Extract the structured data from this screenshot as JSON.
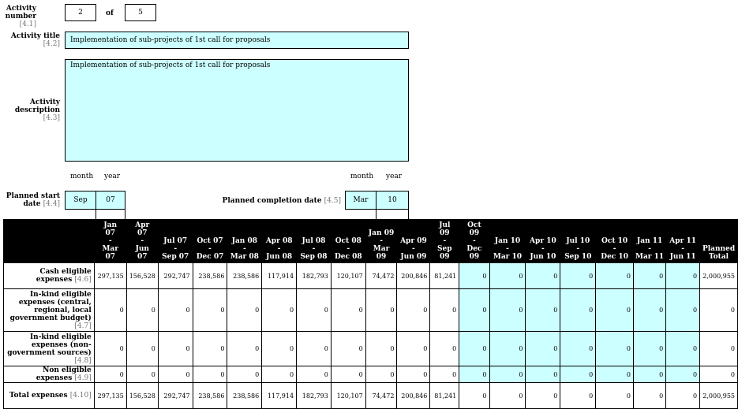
{
  "activity": {
    "number_label": "Activity number",
    "number_ref": "[4.1]",
    "number_value": "2",
    "of_label": "of",
    "total_value": "5",
    "title_label": "Activity title",
    "title_ref": "[4.2]",
    "title_value": "Implementation of sub-projects of 1st call for proposals",
    "desc_label": "Activity description",
    "desc_ref": "[4.3]",
    "desc_value": "Implementation of sub-projects of 1st call for proposals"
  },
  "dates": {
    "month_label": "month",
    "year_label": "year",
    "start_label": "Planned start date",
    "start_ref": "[4.4]",
    "start_month": "Sep",
    "start_year": "07",
    "completion_label": "Planned completion date",
    "completion_ref": "[4.5]",
    "completion_month": "Mar",
    "completion_year": "10"
  },
  "table": {
    "columns": [
      [
        "Jan",
        "07",
        "-",
        "Mar",
        "07"
      ],
      [
        "Apr",
        "07",
        "-",
        "Jun",
        "07"
      ],
      [
        "Jul 07",
        "-",
        "Sep 07"
      ],
      [
        "Oct 07",
        "-",
        "Dec 07"
      ],
      [
        "Jan 08",
        "-",
        "Mar 08"
      ],
      [
        "Apr 08",
        "-",
        "Jun 08"
      ],
      [
        "Jul 08",
        "-",
        "Sep 08"
      ],
      [
        "Oct 08",
        "-",
        "Dec 08"
      ],
      [
        "Jan 09",
        "-",
        "Mar",
        "09"
      ],
      [
        "Apr 09",
        "-",
        "Jun 09"
      ],
      [
        "Jul",
        "09",
        "-",
        "Sep",
        "09"
      ],
      [
        "Oct",
        "09",
        "-",
        "Dec",
        "09"
      ],
      [
        "Jan 10",
        "-",
        "Mar 10"
      ],
      [
        "Apr 10",
        "-",
        "Jun 10"
      ],
      [
        "Jul 10",
        "-",
        "Sep 10"
      ],
      [
        "Oct 10",
        "-",
        "Dec 10"
      ],
      [
        "Jan 11",
        "-",
        "Mar 11"
      ],
      [
        "Apr 11",
        "-",
        "Jun 11"
      ],
      [
        "Planned",
        "Total"
      ]
    ],
    "rows": [
      {
        "label": "Cash eligible expenses",
        "ref": "[4.6]",
        "values": [
          "297,135",
          "156,528",
          "292,747",
          "238,586",
          "238,586",
          "117,914",
          "182,793",
          "120,107",
          "74,472",
          "200,846",
          "81,241",
          "0",
          "0",
          "0",
          "0",
          "0",
          "0",
          "0",
          "2,000,955"
        ]
      },
      {
        "label": "In-kind eligible expenses (central, regional, local government budget)",
        "ref": "[4.7]",
        "values": [
          "0",
          "0",
          "0",
          "0",
          "0",
          "0",
          "0",
          "0",
          "0",
          "0",
          "0",
          "0",
          "0",
          "0",
          "0",
          "0",
          "0",
          "0",
          "0"
        ]
      },
      {
        "label": "In-kind eligible expenses (non-government sources)",
        "ref": "[4.8]",
        "values": [
          "0",
          "0",
          "0",
          "0",
          "0",
          "0",
          "0",
          "0",
          "0",
          "0",
          "0",
          "0",
          "0",
          "0",
          "0",
          "0",
          "0",
          "0",
          "0"
        ]
      },
      {
        "label": "Non eligible expenses",
        "ref": "[4.9]",
        "values": [
          "0",
          "0",
          "0",
          "0",
          "0",
          "0",
          "0",
          "0",
          "0",
          "0",
          "0",
          "0",
          "0",
          "0",
          "0",
          "0",
          "0",
          "0",
          "0"
        ]
      },
      {
        "label": "Total expenses",
        "ref": "[4.10]",
        "values": [
          "297,135",
          "156,528",
          "292,747",
          "238,586",
          "238,586",
          "117,914",
          "182,793",
          "120,107",
          "74,472",
          "200,846",
          "81,241",
          "0",
          "0",
          "0",
          "0",
          "0",
          "0",
          "0",
          "2,000,955"
        ]
      }
    ]
  }
}
